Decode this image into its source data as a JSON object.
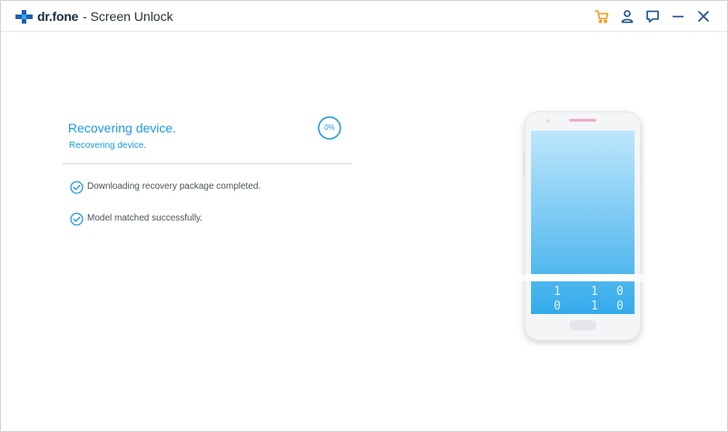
{
  "header": {
    "brand": "dr.fone",
    "title": "- Screen Unlock",
    "icons": [
      "cart-icon",
      "user-icon",
      "feedback-icon",
      "minimize-icon",
      "close-icon"
    ]
  },
  "status": {
    "title": "Recovering device.",
    "subtitle": "Recovering device.",
    "progress_label": "0%",
    "progress_fraction": 0
  },
  "steps": [
    {
      "label": "Downloading recovery package completed.",
      "done": true
    },
    {
      "label": "Model matched successfully.",
      "done": true
    }
  ],
  "phone": {
    "bits_row1": [
      "1",
      "1",
      "0"
    ],
    "bits_row2": [
      "0",
      "1",
      "0"
    ]
  },
  "colors": {
    "accent": "#1f9ae0",
    "cart": "#f39c12",
    "brand": "#1b5fb5",
    "screen_top": "#bde6fb",
    "screen_bottom": "#34abeb"
  }
}
